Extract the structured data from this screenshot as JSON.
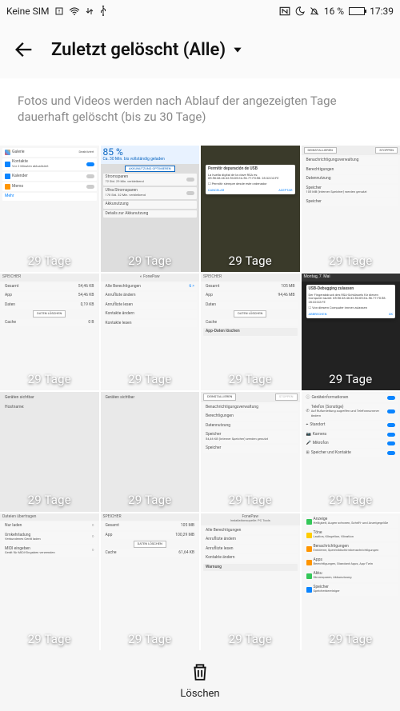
{
  "status": {
    "sim": "Keine SIM",
    "battery_pct": "16 %",
    "clock": "17:39"
  },
  "header": {
    "title": "Zuletzt gelöscht (Alle)"
  },
  "info": "Fotos und Videos werden nach Ablauf der angezeigten Tage dauerhaft gelöscht (bis zu 30 Tage)",
  "days_label": "29 Tage",
  "bottom": {
    "delete_label": "Löschen"
  },
  "t": {
    "r1": {
      "c1": {
        "galerie": "Galerie",
        "deact": "Deaktiviert",
        "kontakte": "Kontakte",
        "kontakte_sub": "Vor 2 Minuten aktualisiert",
        "kalender": "Kalender",
        "memo": "Memo",
        "mehr": "Mehr"
      },
      "c2": {
        "pct": "85 %",
        "sub": "Ca. 30 Min. bis vollständig geladen",
        "opt": "AKKUNUTZUNG OPTIMIEREN",
        "spar": "Stromsparen",
        "spar_sub": "72 Std. 29 Min. verbleibend",
        "ultra": "Ultra-Stromsparen",
        "ultra_sub": "178 Std. 32 Min. verbleibend",
        "akku": "Akkunutzung",
        "details": "Details zur Akkunutzung"
      },
      "c3": {
        "title": "Permitir depuración de USB",
        "body": "La huella digital de la clave RSA es: 85:58:38:46:32:53:05.EA.56.77.F0:58: 28:32:D2:FE",
        "chk": "Permitir siempre desde este ordenador",
        "cancel": "CANCELAR",
        "ok": "ACEPTAR"
      },
      "c4": {
        "deinst": "DEINSTALLIEREN",
        "stop": "STOPPEN",
        "a": "Benachrichtigungsverwaltung",
        "b": "Berechtigungen",
        "c": "Datennutzung",
        "d": "Speicher",
        "d_sub": "105 MB (interner Speicher) werden genutzt",
        "e": "Speicher"
      }
    },
    "r2": {
      "c1": {
        "hdr": "SPEICHER",
        "gesamt": "Gesamt",
        "gv": "54,46 KB",
        "app": "App",
        "av": "54,46 KB",
        "daten": "Daten",
        "dv": "0,19 KB",
        "btn": "DATEN LÖSCHEN",
        "cache": "Cache",
        "cv": "0 B"
      },
      "c2": {
        "title": "FonePaw",
        "perm": "Alle Berechtigungen",
        "b1": "Anrufliste ändern",
        "b2": "Anrufliste lesen",
        "b3": "Kontakte ändern",
        "b4": "Kontakte lesen"
      },
      "c3": {
        "hdr": "SPEICHER",
        "gesamt": "Gesamt",
        "gv": "105 MB",
        "app": "App",
        "av": "94,46 MB",
        "daten": "Daten",
        "btn": "DATEN LÖSCHEN",
        "cache": "Cache",
        "app_del": "App-Daten löschen"
      },
      "c4": {
        "date": "Montag, 7. Mai",
        "title": "USB-Debugging zulassen",
        "body": "Der Fingerabdruck des RSA-Schlüssels für diesen Computer lautet: 85:58:38:46:32:53:05.EA.56.77.F0:58: 28:32:D2:FE",
        "chk": "Von diesem Computer immer zulassen",
        "cancel": "ABBRECHEN",
        "ok": "OK"
      }
    },
    "r3": {
      "c1": {
        "a": "Geräten sichtbar",
        "b": "Hostname:"
      },
      "c2": {
        "a": "Geräten sichtbar"
      },
      "c3": {
        "deinst": "DEINSTALLIEREN",
        "stop": "STOPPEN",
        "a": "Benachrichtigungsverwaltung",
        "b": "Berechtigungen",
        "c": "Datennutzung",
        "d": "Speicher",
        "d_sub": "54,46 KB (interner Speicher) werden genutzt",
        "e": "Speicher"
      },
      "c4": {
        "a": "Geräteinformationen",
        "b": "Telefon (Sonstige)",
        "b_sub": "Auf Rufumleitung zugreifen und Telefonnummer ändern",
        "c": "Standort",
        "d": "Kamera",
        "e": "Mikrofon",
        "f": "Speicher und Kontakte"
      }
    },
    "r4": {
      "c1": {
        "a": "Dateien übertragen",
        "b": "Nur laden",
        "c": "Umkehrladung",
        "c_sub": "Verbundenes Gerät laden",
        "d": "MIDI eingeben",
        "d_sub": "Gerät für MIDI-Eingaben verwenden"
      },
      "c2": {
        "hdr": "SPEICHER",
        "gesamt": "Gesamt",
        "gv": "105 MB",
        "app": "App",
        "av": "100,29 MB",
        "btn": "DATEN LÖSCHEN",
        "cache": "Cache",
        "cv": "61,64 KB"
      },
      "c3": {
        "title": "FonePaw",
        "sub": "Installationsquelle: PC Tools",
        "perm": "Alle Berechtigungen",
        "b1": "Anrufliste ändern",
        "b2": "Anrufliste lesen",
        "b3": "Kontakte ändern",
        "warn": "Warnung"
      },
      "c4": {
        "a": "Anzeige",
        "a_sub": "Helligkeit, Augen schonen, Schrift- und Anzeigegröße",
        "b": "Töne",
        "b_sub": "Lautlos, Klingelton, Vibration",
        "c": "Benachrichtigungen",
        "c_sub": "Embleme, Sperrbildschirmbenachrichtigungen",
        "d": "Apps",
        "d_sub": "Berechtigungen, Standard-Apps, App-Twin",
        "e": "Akku",
        "e_sub": "Stromsparen, Akkunutzung",
        "f": "Speicher",
        "f_sub": "Speicherbereiniger"
      }
    }
  }
}
